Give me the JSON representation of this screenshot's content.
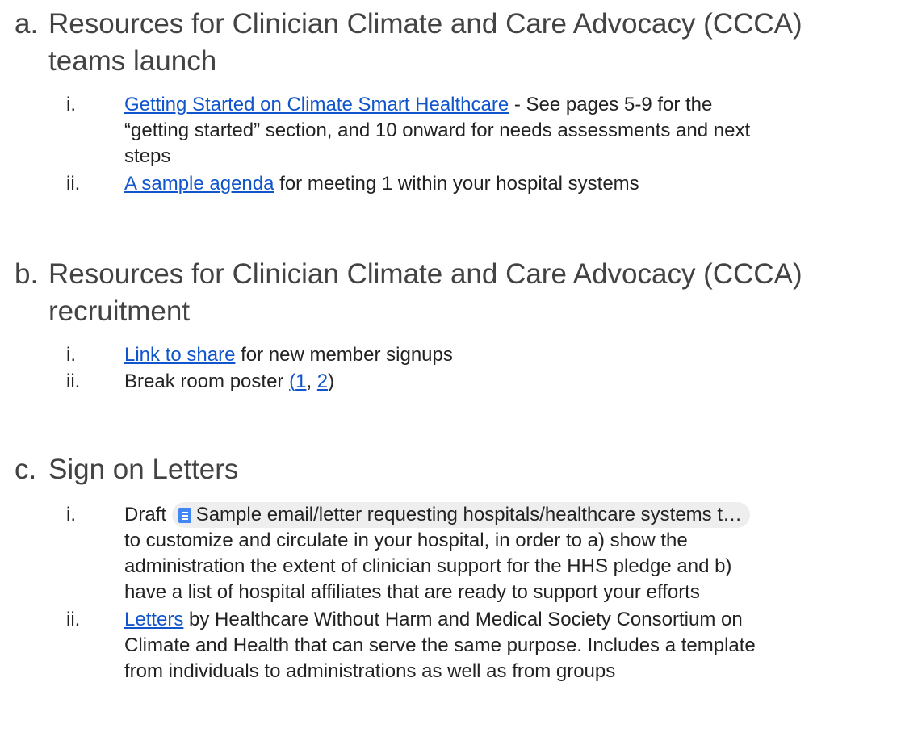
{
  "sections": [
    {
      "marker": "a.",
      "title_line1": "Resources for Clinician Climate and Care Advocacy (CCCA)",
      "title_line2": "teams launch",
      "items": [
        {
          "marker": "i.",
          "link": "Getting Started on Climate Smart Healthcare",
          "line1_rest": " - See pages 5-9 for the",
          "line2": "“getting started” section, and 10 onward for needs assessments and next",
          "line3": "steps"
        },
        {
          "marker": "ii.",
          "link": "A sample agenda",
          "rest": " for meeting 1 within your hospital systems"
        }
      ]
    },
    {
      "marker": "b.",
      "title_line1": "Resources for Clinician Climate and Care Advocacy (CCCA)",
      "title_line2": "recruitment",
      "items": [
        {
          "marker": "i.",
          "link": "Link to share",
          "rest": " for new member signups"
        },
        {
          "marker": "ii.",
          "prefix": "Break room poster ",
          "open_paren": "(",
          "link1": "1",
          "sep": ", ",
          "link2": "2",
          "close_paren": ")"
        }
      ]
    },
    {
      "marker": "c.",
      "title": "Sign on Letters",
      "items": [
        {
          "marker": "i.",
          "prefix": "Draft ",
          "chip": "Sample email/letter requesting hospitals/healthcare systems t…",
          "line2": "to customize and circulate in your hospital, in order to a) show the",
          "line3": "administration the extent of clinician support for the HHS pledge and b)",
          "line4": "have a list of hospital affiliates that are ready to support your efforts"
        },
        {
          "marker": "ii.",
          "link": "Letters",
          "line1_rest": " by Healthcare Without Harm and Medical Society Consortium on",
          "line2": "Climate and Health that can serve the same purpose. Includes a template",
          "line3": "from individuals to administrations as well as from groups"
        }
      ]
    }
  ],
  "colors": {
    "heading": "#434343",
    "body": "#222222",
    "link": "#1155cc",
    "chip_bg": "#eeeeee",
    "doc_icon": "#4285f4"
  },
  "icons": {
    "chip_icon": "google-docs-icon"
  }
}
